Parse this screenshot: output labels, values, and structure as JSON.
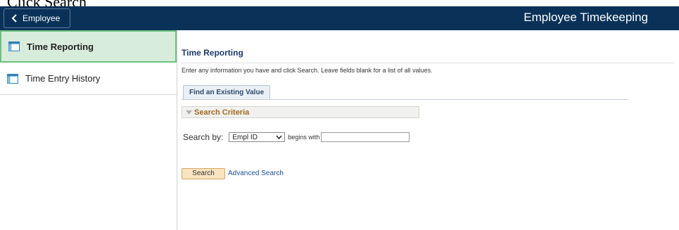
{
  "caption": "Click Search",
  "header": {
    "back_label": "Employee",
    "title": "Employee Timekeeping"
  },
  "sidebar": {
    "items": [
      {
        "label": "Time Reporting",
        "active": true
      },
      {
        "label": "Time Entry History",
        "active": false
      }
    ]
  },
  "main": {
    "title": "Time Reporting",
    "instructions": "Enter any information you have and click Search. Leave fields blank for a list of all values.",
    "tab_label": "Find an Existing Value",
    "criteria_label": "Search Criteria",
    "search_by_label": "Search by:",
    "search_field_value": "Empl ID",
    "operator_label": "begins with",
    "search_value": "",
    "search_button_label": "Search",
    "advanced_link_label": "Advanced Search"
  },
  "colors": {
    "header_bg": "#0a3258",
    "active_item_bg": "#d8ecdc",
    "active_item_border": "#6cc07f",
    "criteria_text": "#a26a1e",
    "search_button_bg": "#fbe3bf",
    "link": "#1f4e96"
  }
}
